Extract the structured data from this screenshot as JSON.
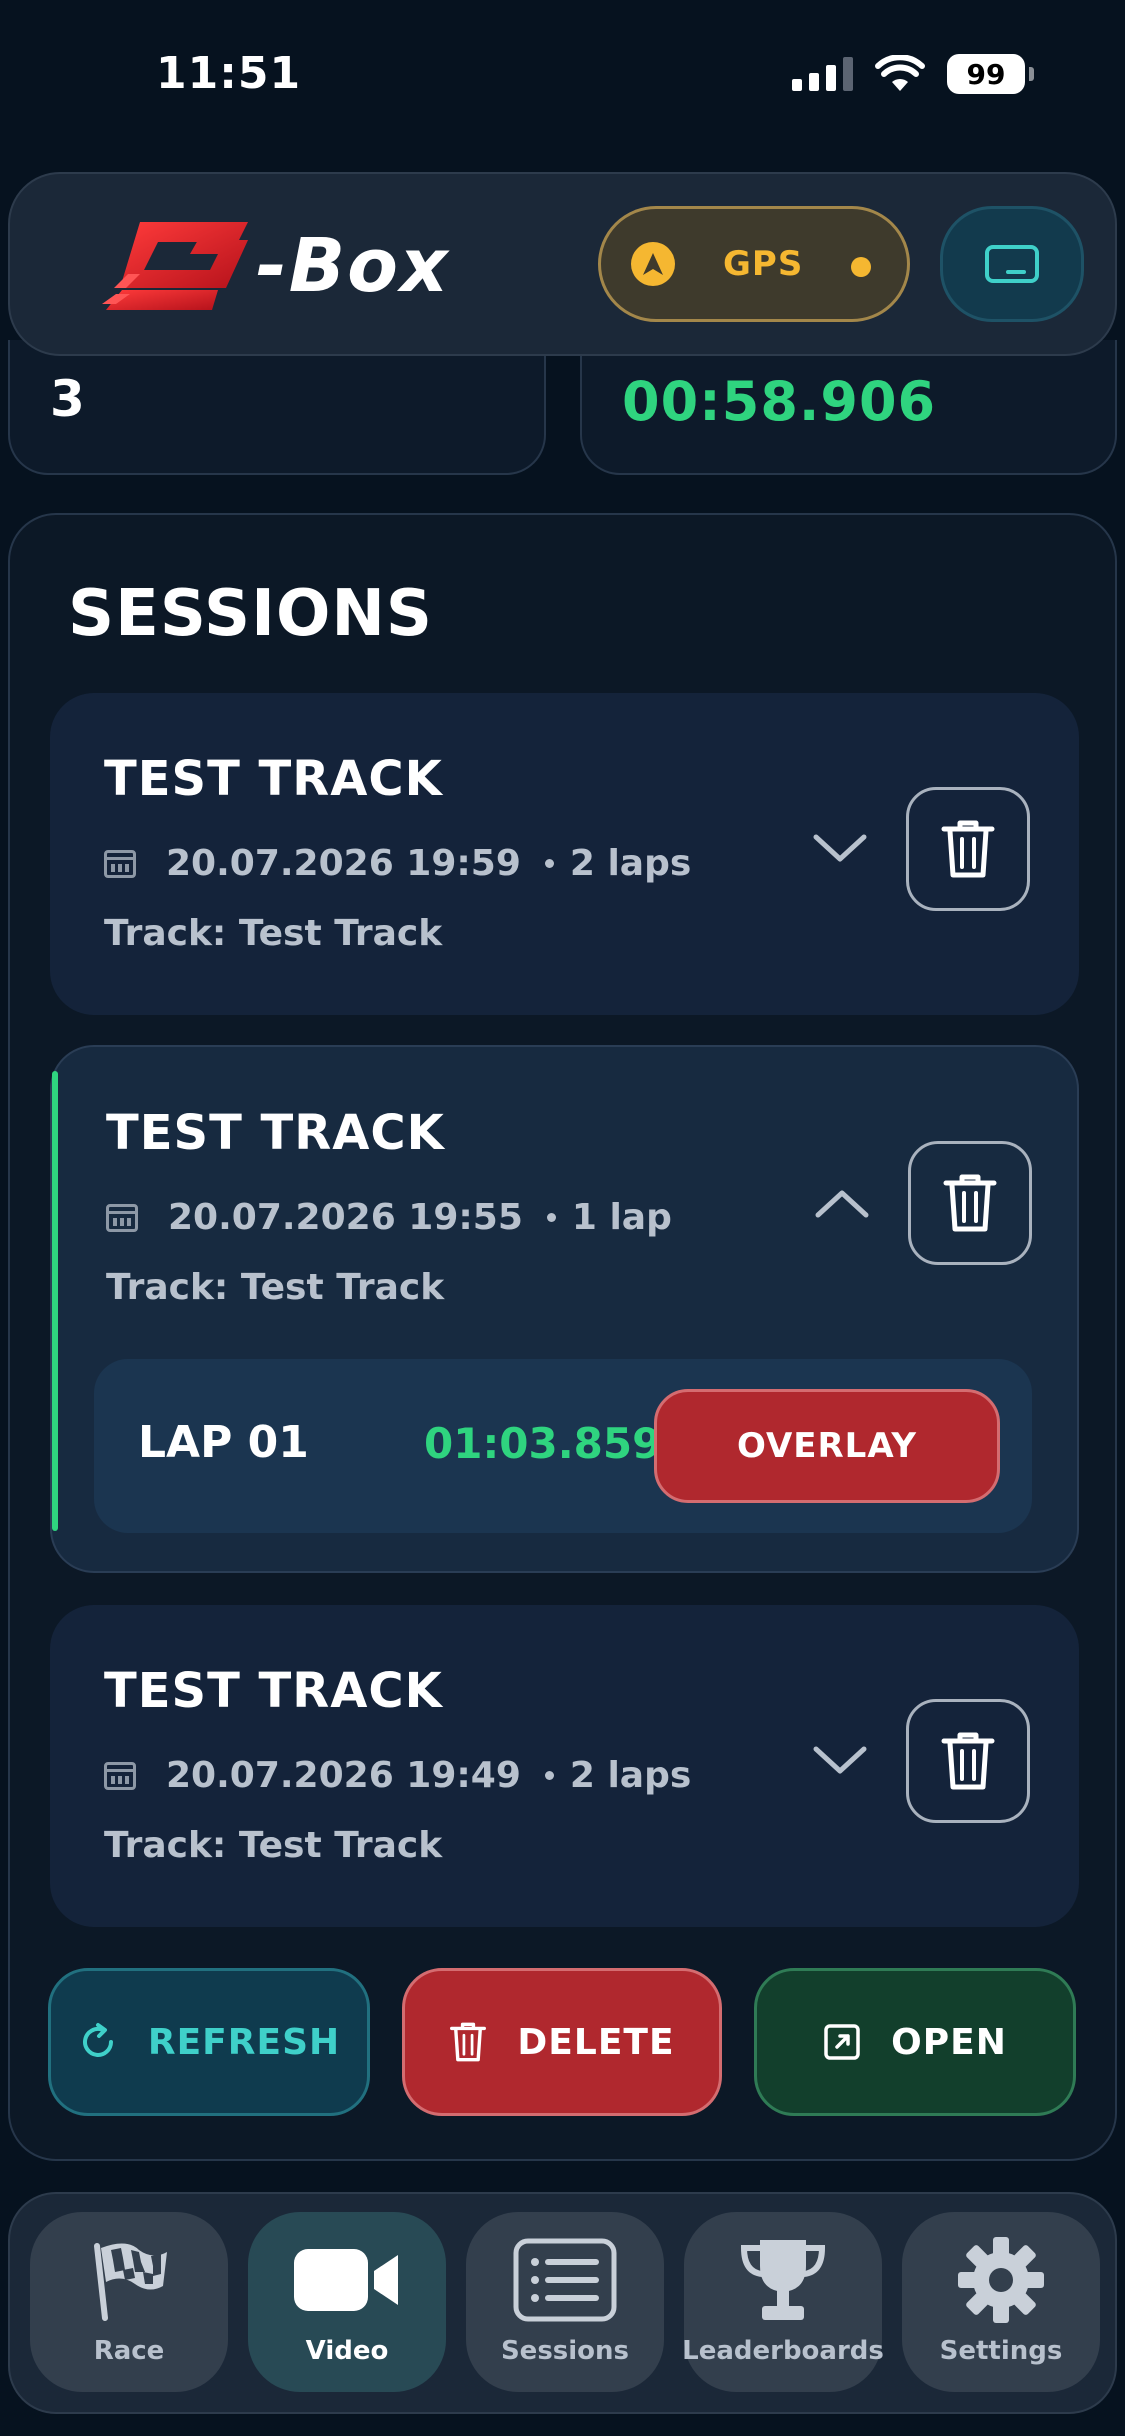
{
  "status_bar": {
    "time": "11:51",
    "battery": "99"
  },
  "header": {
    "logo_text": "-Box",
    "gps_label": "GPS"
  },
  "stats": {
    "left_value": "3",
    "right_value": "00:58.906"
  },
  "sessions": {
    "title": "SESSIONS",
    "items": [
      {
        "title": "TEST TRACK",
        "datetime": "20.07.2026 19:59",
        "laps": "2 laps",
        "track": "Track: Test Track",
        "expanded": false
      },
      {
        "title": "TEST TRACK",
        "datetime": "20.07.2026 19:55",
        "laps": "1 lap",
        "track": "Track: Test Track",
        "expanded": true,
        "lap": {
          "label": "LAP 01",
          "time": "01:03.859",
          "overlay_label": "OVERLAY"
        }
      },
      {
        "title": "TEST TRACK",
        "datetime": "20.07.2026 19:49",
        "laps": "2 laps",
        "track": "Track: Test Track",
        "expanded": false
      }
    ],
    "actions": {
      "refresh": "REFRESH",
      "delete": "DELETE",
      "open": "OPEN"
    }
  },
  "nav": {
    "items": [
      {
        "label": "Race",
        "icon": "flag-icon"
      },
      {
        "label": "Video",
        "icon": "video-camera-icon"
      },
      {
        "label": "Sessions",
        "icon": "list-icon"
      },
      {
        "label": "Leaderboards",
        "icon": "trophy-icon"
      },
      {
        "label": "Settings",
        "icon": "gear-icon"
      }
    ],
    "active": "Video"
  },
  "colors": {
    "accent_green": "#2fd47f",
    "gps_yellow": "#f5b731",
    "danger_red": "#b0282e",
    "teal": "#3fd0c9",
    "background": "#06121f"
  }
}
